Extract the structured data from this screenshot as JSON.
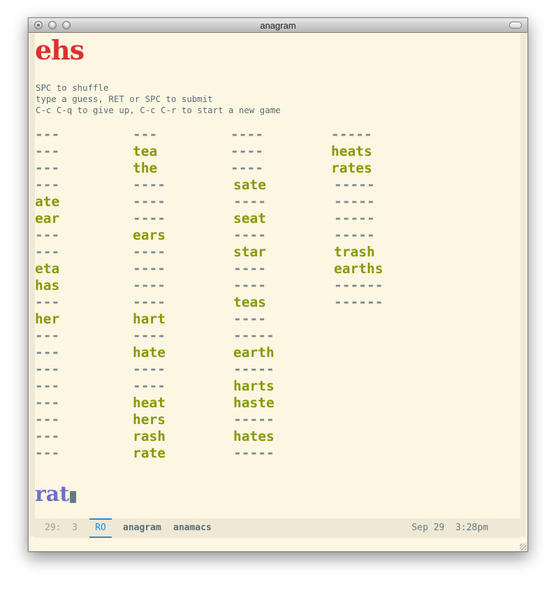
{
  "window": {
    "title": "anagram"
  },
  "game": {
    "letters": "ehs",
    "help_lines": [
      "SPC to shuffle",
      "type a guess, RET or SPC to submit",
      "C-c C-q to give up, C-c C-r to start a new game"
    ],
    "columns": [
      [
        "---",
        "---",
        "---",
        "---",
        "ate",
        "ear",
        "---",
        "---",
        "eta",
        "has",
        "---",
        "her",
        "---",
        "---",
        "---",
        "---",
        "---",
        "---",
        "---",
        "---"
      ],
      [
        "---",
        "tea",
        "the",
        "----",
        "----",
        "----",
        "ears",
        "----",
        "----",
        "----",
        "----",
        "hart",
        "----",
        "hate",
        "----",
        "----",
        "heat",
        "hers",
        "rash",
        "rate"
      ],
      [
        "----",
        "----",
        "----",
        "sate",
        "----",
        "seat",
        "----",
        "star",
        "----",
        "----",
        "teas",
        "----",
        "-----",
        "earth",
        "-----",
        "harts",
        "haste",
        "-----",
        "hates",
        "-----"
      ],
      [
        "-----",
        "heats",
        "rates",
        "-----",
        "-----",
        "-----",
        "-----",
        "trash",
        "earths",
        "------",
        "------"
      ]
    ],
    "current_input": "rat"
  },
  "modeline": {
    "position": "29:  3",
    "read_only": "RO",
    "buffer_name": "anagram",
    "major_mode": "anamacs",
    "datetime": "Sep 29  3:28pm"
  },
  "colors": {
    "background": "#fdf6e3",
    "letters": "#dc322f",
    "found_word": "#859900",
    "blank_word": "#7c8b8f",
    "input": "#6c71c4",
    "accent": "#268bd2"
  }
}
